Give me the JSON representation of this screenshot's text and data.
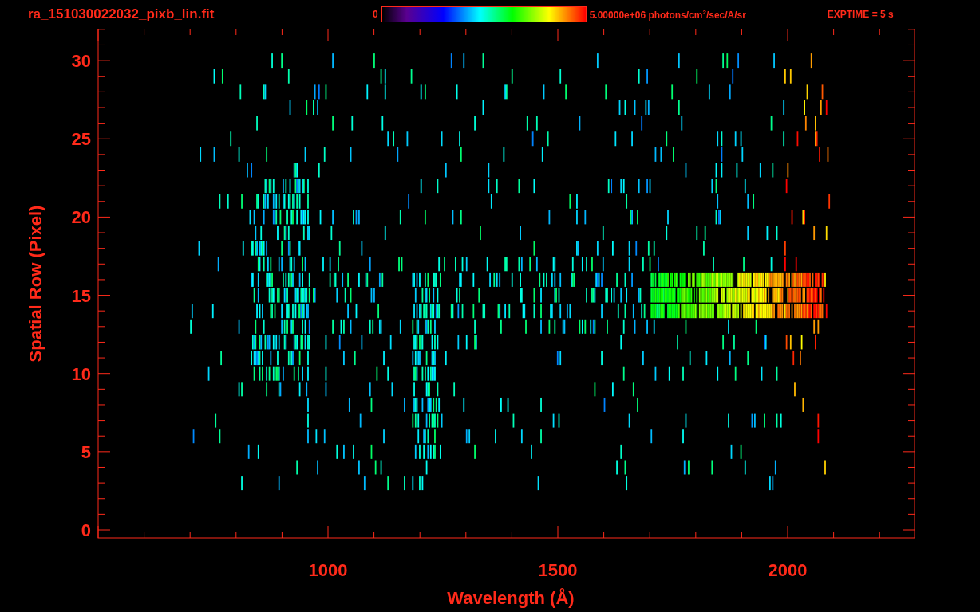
{
  "header": {
    "title": "ra_151030022032_pixb_lin.fit",
    "colorbar": {
      "min_label": "0",
      "max_label": "5.00000e+06 photons/cm$^{2}$/sec/A/sr"
    },
    "exposure": "EXPTIME = 5 s"
  },
  "plot": {
    "xlabel": "Wavelength (Å)",
    "ylabel": "Spatial Row (Pixel)",
    "xticks": [
      "1000",
      "1500",
      "2000"
    ],
    "yticks": [
      "30",
      "25",
      "20",
      "15",
      "10",
      "5",
      "0"
    ]
  }
}
